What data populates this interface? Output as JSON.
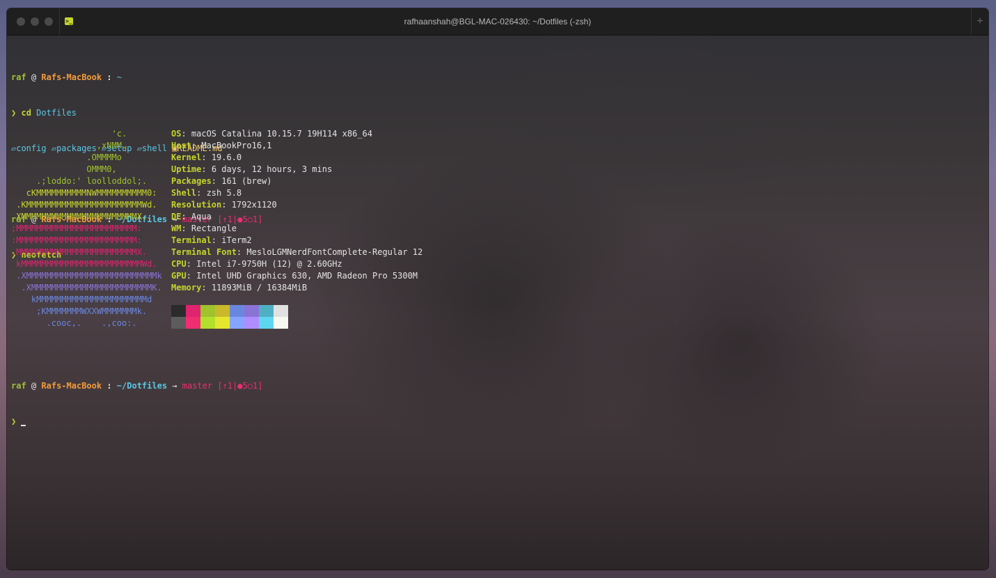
{
  "window": {
    "title": "rafhaanshah@BGL-MAC-026430: ~/Dotfiles (-zsh)",
    "terminal_icon": ">_",
    "new_tab": "+"
  },
  "prompt1": {
    "user": "raf",
    "at": "@",
    "host": "Rafs-MacBook",
    "colon": ":",
    "path": "~",
    "prompt_char": "❯",
    "command": "cd",
    "arg": "Dotfiles"
  },
  "ls": {
    "items": [
      "config",
      "packages",
      "setup",
      "shell"
    ],
    "file": "README.md"
  },
  "prompt2": {
    "user": "raf",
    "at": "@",
    "host": "Rafs-MacBook",
    "colon": ":",
    "path": "~/Dotfiles",
    "arrow": "→",
    "branch": "master",
    "status": "[↑1|●5○1]",
    "prompt_char": "❯",
    "command": "neofetch"
  },
  "neofetch": {
    "art": [
      {
        "text": "                    'c.",
        "color": "#9fc22d"
      },
      {
        "text": "                 ,xNMM.",
        "color": "#9fc22d"
      },
      {
        "text": "               .OMMMMo",
        "color": "#9fc22d"
      },
      {
        "text": "               OMMM0,",
        "color": "#9fc22d"
      },
      {
        "text": "     .;loddo:' loolloddol;.",
        "color": "#9fc22d"
      },
      {
        "text": "   cKMMMMMMMMMMNWMMMMMMMMMM0:",
        "color": "#c6d52a"
      },
      {
        "text": " .KMMMMMMMMMMMMMMMMMMMMMMMWd.",
        "color": "#c6d52a"
      },
      {
        "text": " XMMMMMMMMMMMMMMMMMMMMMMMX.",
        "color": "#c6d52a"
      },
      {
        "text": ";MMMMMMMMMMMMMMMMMMMMMMMM:",
        "color": "#e0236f"
      },
      {
        "text": ":MMMMMMMMMMMMMMMMMMMMMMMM:",
        "color": "#e0236f"
      },
      {
        "text": ".MMMMMMMMMMMMMMMMMMMMMMMMX.",
        "color": "#e0236f"
      },
      {
        "text": " kMMMMMMMMMMMMMMMMMMMMMMMMWd.",
        "color": "#e0236f"
      },
      {
        "text": " .XMMMMMMMMMMMMMMMMMMMMMMMMMMk",
        "color": "#8a73d6"
      },
      {
        "text": "  .XMMMMMMMMMMMMMMMMMMMMMMMMK.",
        "color": "#8a73d6"
      },
      {
        "text": "    kMMMMMMMMMMMMMMMMMMMMMMd",
        "color": "#6a87e0"
      },
      {
        "text": "     ;KMMMMMMMWXXWMMMMMMMk.",
        "color": "#6a87e0"
      },
      {
        "text": "       .cooc,.    .,coo:.",
        "color": "#6a87e0"
      }
    ],
    "info": [
      {
        "key": "OS",
        "value": "macOS Catalina 10.15.7 19H114 x86_64"
      },
      {
        "key": "Host",
        "value": "MacBookPro16,1"
      },
      {
        "key": "Kernel",
        "value": "19.6.0"
      },
      {
        "key": "Uptime",
        "value": "6 days, 12 hours, 3 mins"
      },
      {
        "key": "Packages",
        "value": "161 (brew)"
      },
      {
        "key": "Shell",
        "value": "zsh 5.8"
      },
      {
        "key": "Resolution",
        "value": "1792x1120"
      },
      {
        "key": "DE",
        "value": "Aqua"
      },
      {
        "key": "WM",
        "value": "Rectangle"
      },
      {
        "key": "Terminal",
        "value": "iTerm2"
      },
      {
        "key": "Terminal Font",
        "value": "MesloLGMNerdFontComplete-Regular 12"
      },
      {
        "key": "CPU",
        "value": "Intel i7-9750H (12) @ 2.60GHz"
      },
      {
        "key": "GPU",
        "value": "Intel UHD Graphics 630, AMD Radeon Pro 5300M"
      },
      {
        "key": "Memory",
        "value": "11893MiB / 16384MiB"
      }
    ],
    "palette_row1": [
      "#2b2b2b",
      "#e0236f",
      "#9fc22d",
      "#c9b92a",
      "#6a87e0",
      "#8a73d6",
      "#4fb0c4",
      "#e1e1e1"
    ],
    "palette_row2": [
      "#5c5c5c",
      "#f12d72",
      "#b2e02c",
      "#e6e62f",
      "#84a4ff",
      "#b08dff",
      "#5ed6f0",
      "#f8f8f2"
    ]
  },
  "prompt3": {
    "user": "raf",
    "at": "@",
    "host": "Rafs-MacBook",
    "colon": ":",
    "path": "~/Dotfiles",
    "arrow": "→",
    "branch": "master",
    "status": "[↑1|●5○1]",
    "prompt_char": "❯"
  }
}
